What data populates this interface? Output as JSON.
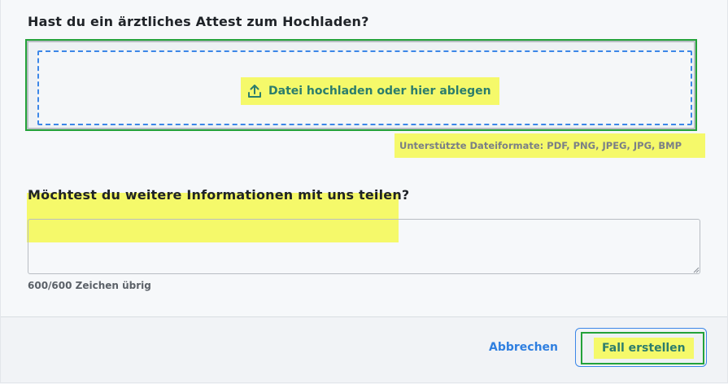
{
  "form": {
    "attachment_question": "Hast du ein ärztliches Attest zum Hochladen?",
    "upload_label": "Datei hochladen  oder hier ablegen",
    "upload_icon": "upload-icon",
    "supported_formats": "Unterstützte Dateiformate: PDF, PNG, JPEG, JPG, BMP",
    "info_question": "Möchtest du weitere Informationen mit uns teilen?",
    "info_value": "",
    "char_counter": "600/600 Zeichen übrig"
  },
  "footer": {
    "cancel_label": "Abbrechen",
    "submit_label": "Fall erstellen"
  },
  "colors": {
    "accent_blue": "#3c87e8",
    "accent_teal": "#2c7d6c",
    "highlight_yellow": "#f5f96a",
    "focus_green": "#24a23a"
  }
}
